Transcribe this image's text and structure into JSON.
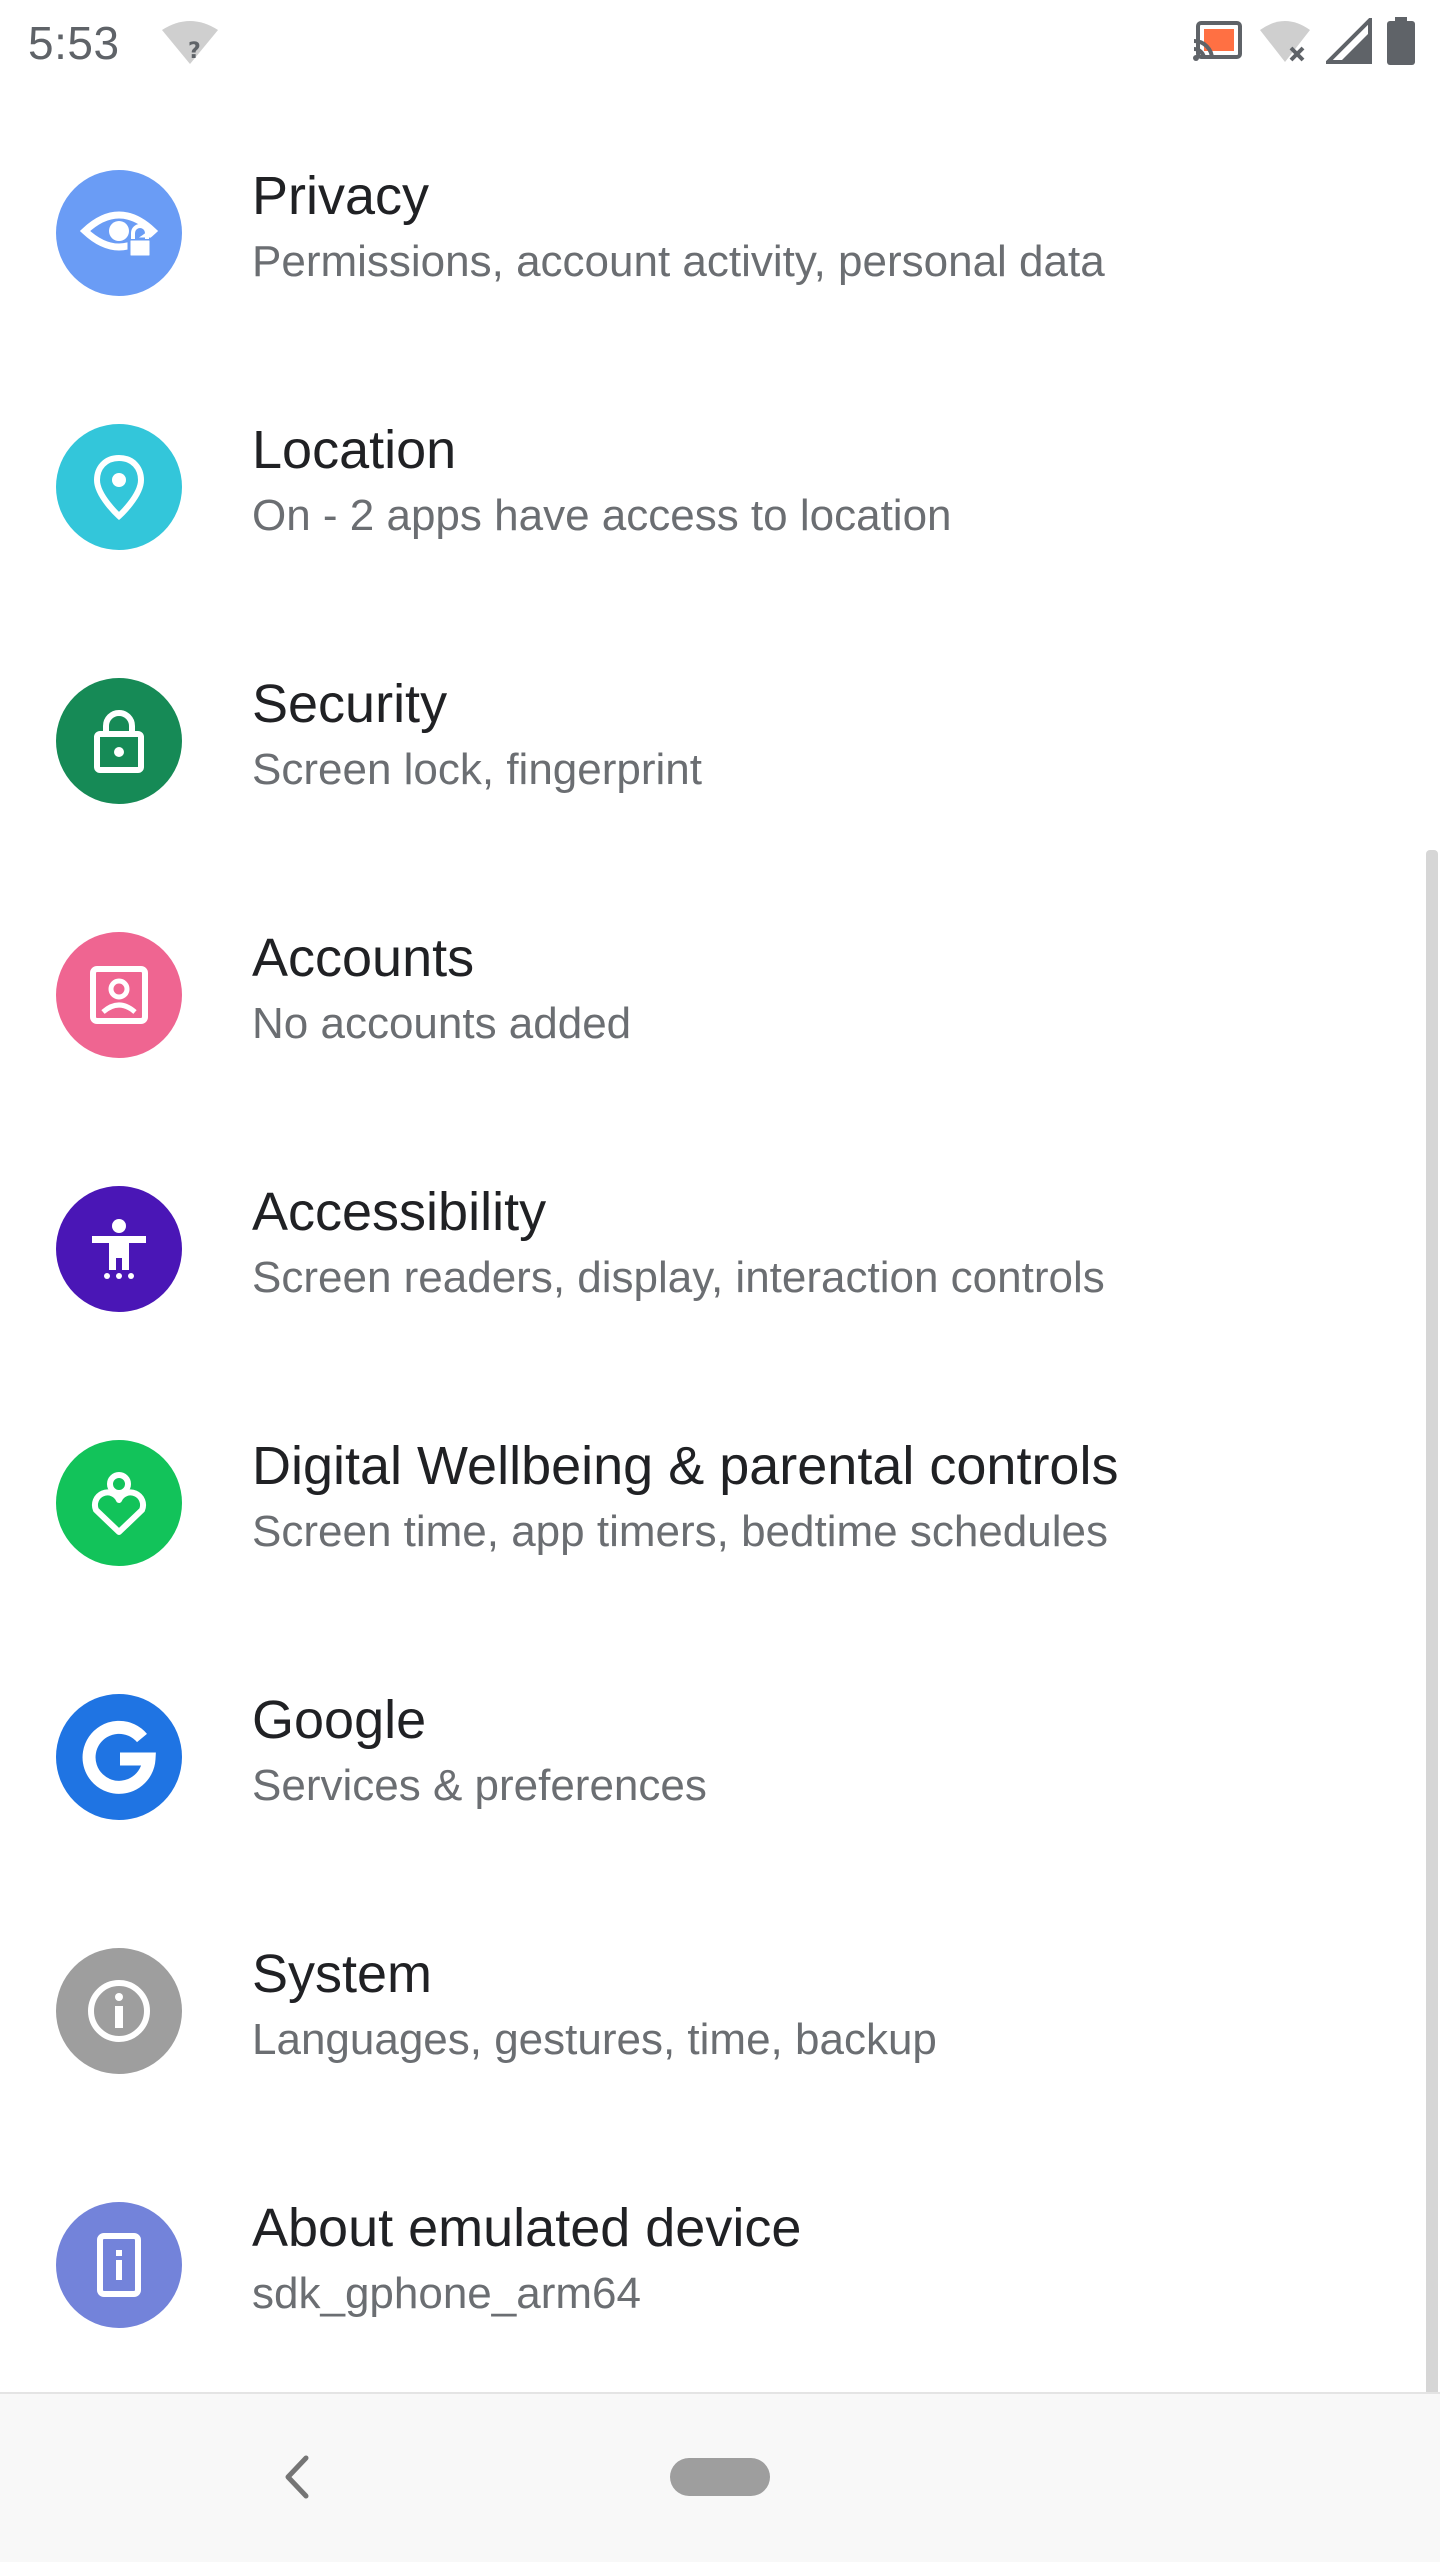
{
  "status_bar": {
    "time": "5:53",
    "left_icons": [
      "wifi-unknown-icon"
    ],
    "right_icons": [
      "cast-icon",
      "wifi-off-icon",
      "cell-signal-icon",
      "battery-icon"
    ],
    "cast_accent_color": "#ff7043"
  },
  "settings": {
    "items": [
      {
        "title": "Privacy",
        "subtitle": "Permissions, account activity, personal data",
        "icon": "privacy-eye-icon",
        "color": "#6a9cf5"
      },
      {
        "title": "Location",
        "subtitle": "On - 2 apps have access to location",
        "icon": "location-pin-icon",
        "color": "#33c6da"
      },
      {
        "title": "Security",
        "subtitle": "Screen lock, fingerprint",
        "icon": "lock-icon",
        "color": "#168a56"
      },
      {
        "title": "Accounts",
        "subtitle": "No accounts added",
        "icon": "account-box-icon",
        "color": "#ef6591"
      },
      {
        "title": "Accessibility",
        "subtitle": "Screen readers, display, interaction controls",
        "icon": "accessibility-icon",
        "color": "#4a16b6"
      },
      {
        "title": "Digital Wellbeing & parental controls",
        "subtitle": "Screen time, app timers, bedtime schedules",
        "icon": "wellbeing-heart-icon",
        "color": "#12c35a"
      },
      {
        "title": "Google",
        "subtitle": "Services & preferences",
        "icon": "google-g-icon",
        "color": "#1f74e3"
      },
      {
        "title": "System",
        "subtitle": "Languages, gestures, time, backup",
        "icon": "info-icon",
        "color": "#9e9e9e"
      },
      {
        "title": "About emulated device",
        "subtitle": "sdk_gphone_arm64",
        "icon": "device-info-icon",
        "color": "#7383da"
      }
    ]
  },
  "nav_bar": {
    "buttons": [
      "back-icon",
      "home-pill"
    ]
  }
}
